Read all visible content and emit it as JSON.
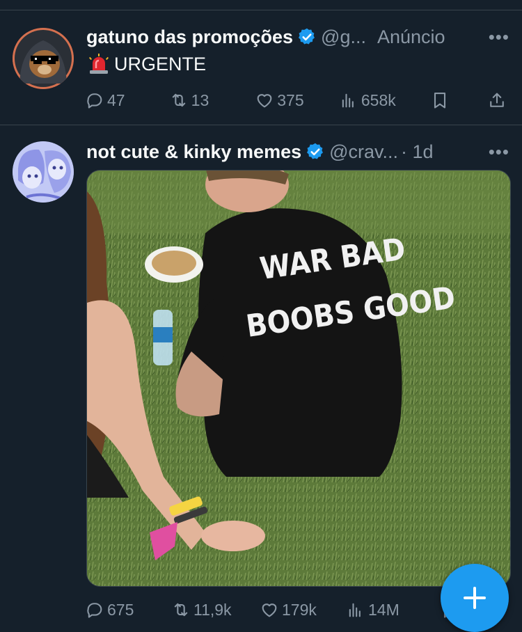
{
  "posts": [
    {
      "name": "gatuno das promoções",
      "handle": "@g...",
      "meta": "Anúncio",
      "text": "URGENTE",
      "actions": {
        "replies": "47",
        "reposts": "13",
        "likes": "375",
        "views": "658k"
      }
    },
    {
      "name": "not cute & kinky memes",
      "handle": "@crav...",
      "meta": "· 1d",
      "image_text": [
        "WAR BAD",
        "BOOBS GOOD"
      ],
      "actions": {
        "replies": "675",
        "reposts": "11,9k",
        "likes": "179k",
        "views": "14M"
      }
    }
  ],
  "more_glyph": "•••",
  "colors": {
    "accent": "#1d9bf0",
    "background": "#15202b",
    "muted": "#8b98a5"
  }
}
